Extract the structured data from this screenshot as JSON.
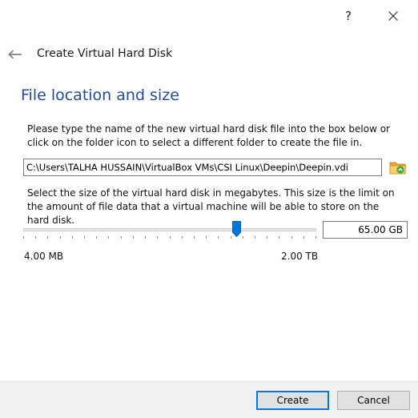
{
  "titlebar": {
    "help_label": "?",
    "close_icon": "close-icon"
  },
  "header": {
    "back_icon": "back-arrow-icon",
    "title": "Create Virtual Hard Disk"
  },
  "page": {
    "title": "File location and size",
    "location_description": "Please type the name of the new virtual hard disk file into the box below or click on the folder icon to select a different folder to create the file in.",
    "file_path": "C:\\Users\\TALHA HUSSAIN\\VirtualBox VMs\\CSI Linux\\Deepin\\Deepin.vdi",
    "folder_icon": "folder-icon",
    "size_description": "Select the size of the virtual hard disk in megabytes. This size is the limit on the amount of file data that a virtual machine will be able to store on the hard disk.",
    "size_value": "65.00 GB",
    "slider_fraction": 0.727,
    "range_min": "4.00 MB",
    "range_max": "2.00 TB"
  },
  "footer": {
    "create_label": "Create",
    "cancel_label": "Cancel"
  },
  "colors": {
    "title_blue": "#1f4a9e",
    "slider_handle": "#0078d7",
    "default_button_border": "#0078d7"
  }
}
